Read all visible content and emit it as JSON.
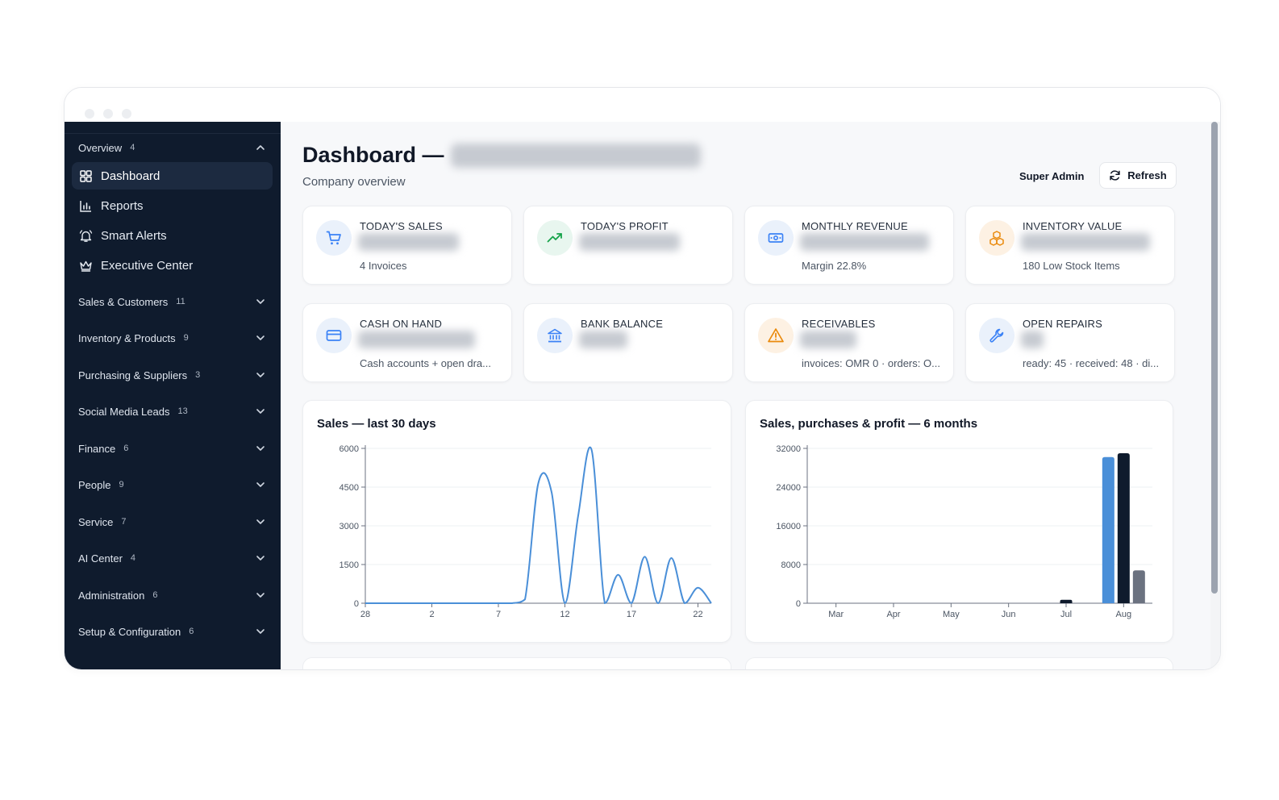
{
  "sidebar": {
    "overview": {
      "label": "Overview",
      "count": "4"
    },
    "items": [
      {
        "label": "Dashboard",
        "icon": "grid-icon"
      },
      {
        "label": "Reports",
        "icon": "bar-chart-icon"
      },
      {
        "label": "Smart Alerts",
        "icon": "bell-icon"
      },
      {
        "label": "Executive Center",
        "icon": "crown-icon"
      }
    ],
    "groups": [
      {
        "label": "Sales & Customers",
        "count": "11"
      },
      {
        "label": "Inventory & Products",
        "count": "9"
      },
      {
        "label": "Purchasing & Suppliers",
        "count": "3"
      },
      {
        "label": "Social Media Leads",
        "count": "13"
      },
      {
        "label": "Finance",
        "count": "6"
      },
      {
        "label": "People",
        "count": "9"
      },
      {
        "label": "Service",
        "count": "7"
      },
      {
        "label": "AI Center",
        "count": "4"
      },
      {
        "label": "Administration",
        "count": "6"
      },
      {
        "label": "Setup & Configuration",
        "count": "6"
      }
    ]
  },
  "header": {
    "title": "Dashboard —",
    "subtitle": "Company overview",
    "user_role": "Super Admin",
    "refresh_label": "Refresh"
  },
  "kpis": [
    {
      "label": "TODAY'S SALES",
      "sub": "4 Invoices",
      "icon": "cart-icon"
    },
    {
      "label": "TODAY'S PROFIT",
      "sub": "",
      "icon": "trending-up-icon"
    },
    {
      "label": "MONTHLY REVENUE",
      "sub": "Margin 22.8%",
      "icon": "banknote-icon"
    },
    {
      "label": "INVENTORY VALUE",
      "sub": "180 Low Stock Items",
      "icon": "boxes-icon"
    },
    {
      "label": "CASH ON HAND",
      "sub": "Cash accounts + open dra...",
      "icon": "credit-card-icon"
    },
    {
      "label": "BANK BALANCE",
      "sub": "",
      "icon": "bank-icon"
    },
    {
      "label": "RECEIVABLES",
      "sub": "invoices: OMR 0 · orders: O...",
      "icon": "warning-icon"
    },
    {
      "label": "OPEN REPAIRS",
      "sub": "ready: 45 · received: 48 · di...",
      "icon": "wrench-icon"
    }
  ],
  "colors": {
    "sidebar_bg": "#0f1b2d",
    "line": "#4a8fd8",
    "bar_sales": "#4a8fd8",
    "bar_purchases": "#0f1b2d",
    "bar_profit": "#6b7280"
  },
  "chart_data": [
    {
      "type": "line",
      "title": "Sales — last 30 days",
      "x": [
        28,
        29,
        30,
        31,
        1,
        2,
        3,
        4,
        5,
        6,
        7,
        8,
        9,
        10,
        11,
        12,
        13,
        14,
        15,
        16,
        17,
        18,
        19,
        20,
        21,
        22,
        23,
        24,
        25,
        26
      ],
      "x_ticks": [
        "28",
        "2",
        "7",
        "12",
        "17",
        "22"
      ],
      "values": [
        0,
        0,
        0,
        0,
        0,
        0,
        0,
        0,
        0,
        0,
        0,
        0,
        150,
        4650,
        4300,
        0,
        3400,
        5950,
        0,
        1100,
        0,
        1800,
        0,
        1750,
        0,
        600,
        0
      ],
      "ylim": [
        0,
        6000
      ],
      "y_ticks": [
        0,
        1500,
        3000,
        4500,
        6000
      ],
      "grid": true
    },
    {
      "type": "bar",
      "title": "Sales, purchases & profit — 6 months",
      "categories": [
        "Mar",
        "Apr",
        "May",
        "Jun",
        "Jul",
        "Aug"
      ],
      "series": [
        {
          "values": [
            0,
            0,
            0,
            0,
            0,
            30200
          ]
        },
        {
          "values": [
            0,
            0,
            0,
            0,
            700,
            31000
          ]
        },
        {
          "values": [
            0,
            0,
            0,
            0,
            0,
            6800
          ]
        }
      ],
      "ylim": [
        0,
        32000
      ],
      "y_ticks": [
        0,
        8000,
        16000,
        24000,
        32000
      ],
      "grid": true
    }
  ]
}
